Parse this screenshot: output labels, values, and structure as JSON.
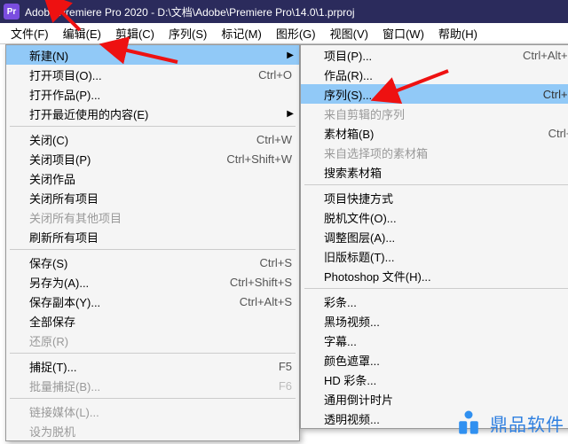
{
  "titlebar": {
    "app_label": "Pr",
    "title": "Adobe Premiere Pro 2020 - D:\\文档\\Adobe\\Premiere Pro\\14.0\\1.prproj"
  },
  "menubar": {
    "items": [
      "文件(F)",
      "编辑(E)",
      "剪辑(C)",
      "序列(S)",
      "标记(M)",
      "图形(G)",
      "视图(V)",
      "窗口(W)",
      "帮助(H)"
    ]
  },
  "file_menu": [
    {
      "label": "新建(N)",
      "submenu": true,
      "hi": true
    },
    {
      "label": "打开项目(O)...",
      "shortcut": "Ctrl+O"
    },
    {
      "label": "打开作品(P)...",
      "shortcut": ""
    },
    {
      "label": "打开最近使用的内容(E)",
      "submenu": true
    },
    {
      "sep": true
    },
    {
      "label": "关闭(C)",
      "shortcut": "Ctrl+W"
    },
    {
      "label": "关闭项目(P)",
      "shortcut": "Ctrl+Shift+W"
    },
    {
      "label": "关闭作品",
      "shortcut": ""
    },
    {
      "label": "关闭所有项目",
      "shortcut": ""
    },
    {
      "label": "关闭所有其他项目",
      "disabled": true
    },
    {
      "label": "刷新所有项目",
      "shortcut": ""
    },
    {
      "sep": true
    },
    {
      "label": "保存(S)",
      "shortcut": "Ctrl+S"
    },
    {
      "label": "另存为(A)...",
      "shortcut": "Ctrl+Shift+S"
    },
    {
      "label": "保存副本(Y)...",
      "shortcut": "Ctrl+Alt+S"
    },
    {
      "label": "全部保存",
      "shortcut": ""
    },
    {
      "label": "还原(R)",
      "disabled": true
    },
    {
      "sep": true
    },
    {
      "label": "捕捉(T)...",
      "shortcut": "F5"
    },
    {
      "label": "批量捕捉(B)...",
      "shortcut": "F6",
      "disabled": true
    },
    {
      "sep": true
    },
    {
      "label": "链接媒体(L)...",
      "disabled": true
    },
    {
      "label": "设为脱机",
      "disabled": true
    }
  ],
  "new_menu": [
    {
      "label": "项目(P)...",
      "shortcut": "Ctrl+Alt+N"
    },
    {
      "label": "作品(R)...",
      "shortcut": ""
    },
    {
      "label": "序列(S)...",
      "shortcut": "Ctrl+N",
      "hi": true
    },
    {
      "label": "来自剪辑的序列",
      "disabled": true
    },
    {
      "label": "素材箱(B)",
      "shortcut": "Ctrl+/"
    },
    {
      "label": "来自选择项的素材箱",
      "disabled": true
    },
    {
      "label": "搜索素材箱",
      "shortcut": ""
    },
    {
      "sep": true
    },
    {
      "label": "项目快捷方式",
      "shortcut": ""
    },
    {
      "label": "脱机文件(O)...",
      "shortcut": ""
    },
    {
      "label": "调整图层(A)...",
      "shortcut": ""
    },
    {
      "label": "旧版标题(T)...",
      "shortcut": ""
    },
    {
      "label": "Photoshop 文件(H)...",
      "shortcut": ""
    },
    {
      "sep": true
    },
    {
      "label": "彩条...",
      "shortcut": ""
    },
    {
      "label": "黑场视频...",
      "shortcut": ""
    },
    {
      "label": "字幕...",
      "shortcut": ""
    },
    {
      "label": "颜色遮罩...",
      "shortcut": ""
    },
    {
      "label": "HD 彩条...",
      "shortcut": ""
    },
    {
      "label": "通用倒计时片",
      "shortcut": ""
    },
    {
      "label": "透明视频...",
      "shortcut": ""
    }
  ],
  "watermark": {
    "text": "鼎品软件"
  }
}
